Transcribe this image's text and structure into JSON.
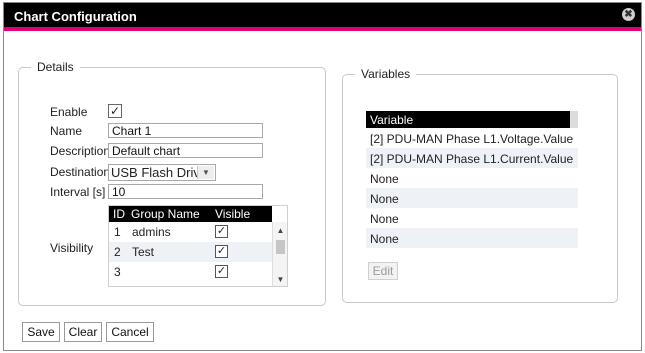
{
  "dialog": {
    "title": "Chart Configuration",
    "close_glyph": "✖"
  },
  "details": {
    "legend": "Details",
    "enable_label": "Enable",
    "enable_checked": true,
    "name_label": "Name",
    "name_value": "Chart 1",
    "description_label": "Description",
    "description_value": "Default chart",
    "destination_label": "Destination",
    "destination_value": "USB Flash Drive",
    "interval_label": "Interval [s]",
    "interval_value": "10",
    "visibility_label": "Visibility",
    "visibility_table": {
      "headers": [
        "ID",
        "Group Name",
        "Visible"
      ],
      "rows": [
        {
          "id": "1",
          "group": "admins",
          "visible": true
        },
        {
          "id": "2",
          "group": "Test",
          "visible": true
        },
        {
          "id": "3",
          "group": "",
          "visible": true
        }
      ]
    }
  },
  "variables": {
    "legend": "Variables",
    "header": "Variable",
    "rows": [
      "[2] PDU-MAN Phase L1.Voltage.Value",
      "[2] PDU-MAN Phase L1.Current.Value",
      "None",
      "None",
      "None",
      "None"
    ],
    "edit_label": "Edit"
  },
  "footer": {
    "save_label": "Save",
    "clear_label": "Clear",
    "cancel_label": "Cancel"
  },
  "colors": {
    "titlebar": "#000000",
    "accent": "#e2007a",
    "row_alt": "#eef1f6"
  },
  "check_glyph": "✓",
  "box_check_glyph": "☑"
}
